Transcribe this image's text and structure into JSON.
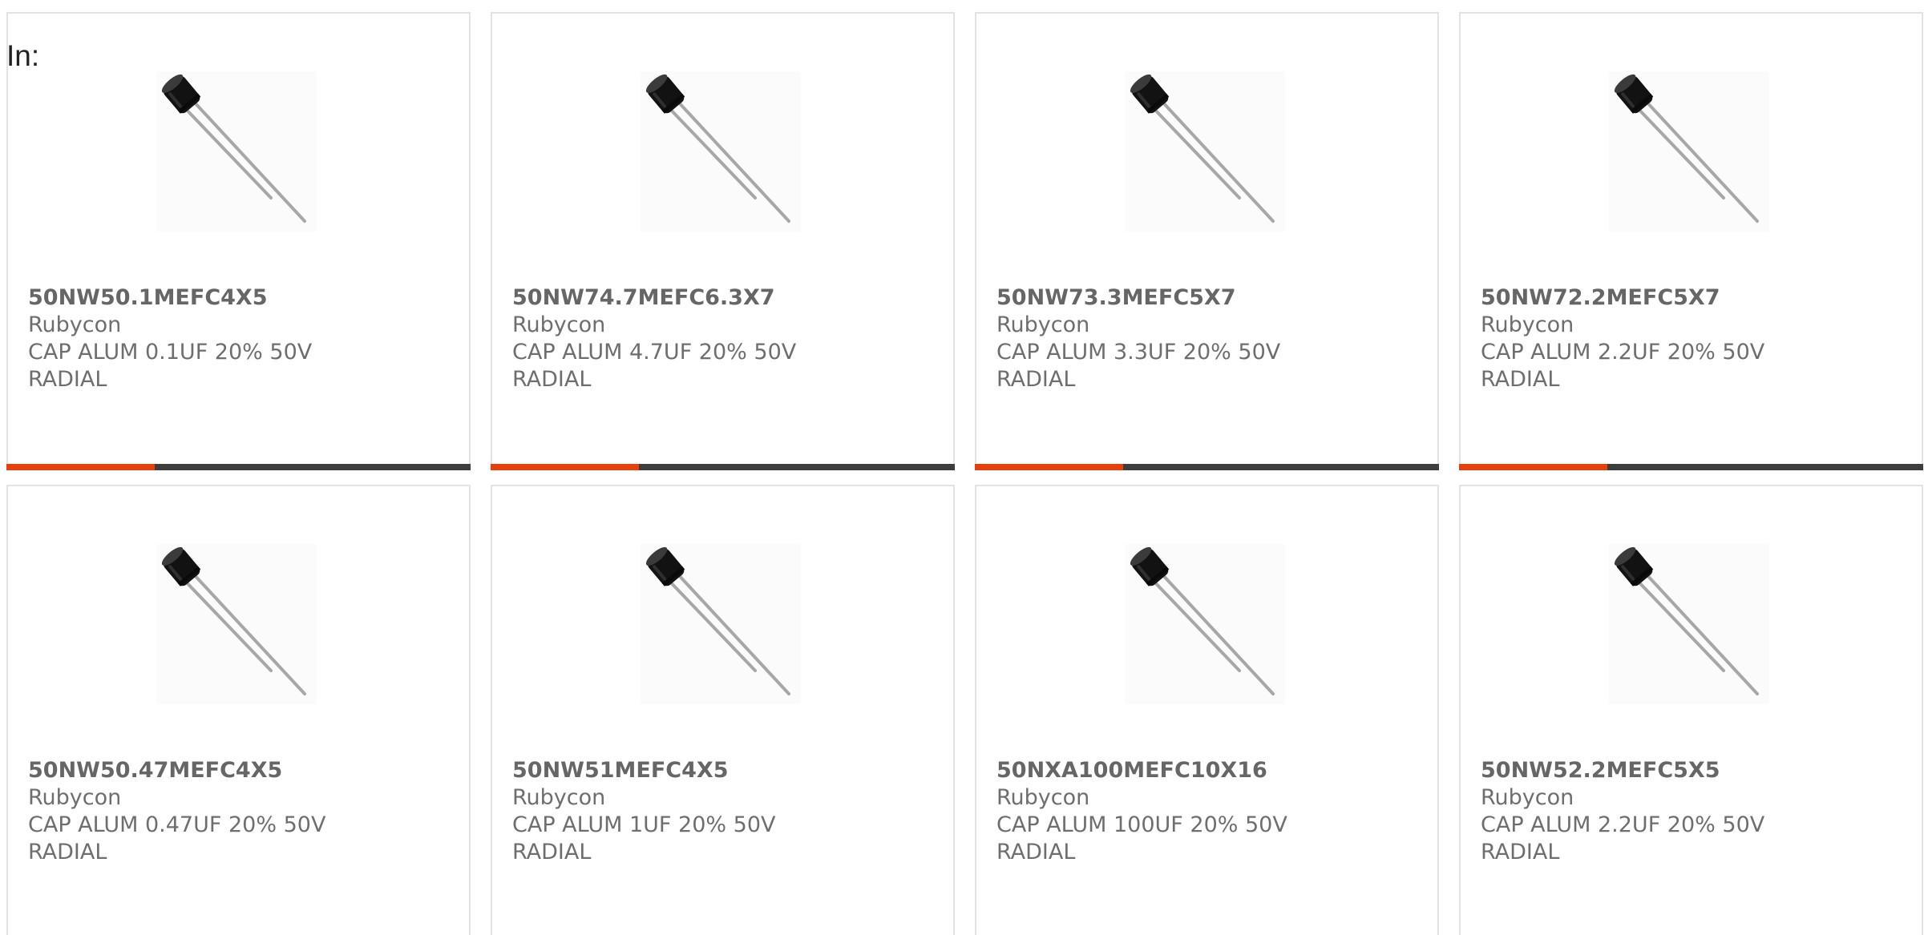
{
  "header": {
    "in_label": "In:"
  },
  "colors": {
    "accent": "#e8400c",
    "bar_base": "#3d3d3d",
    "border": "#e3e3e3",
    "text": "#6e6e6e"
  },
  "products": [
    {
      "part_number": "50NW50.1MEFC4X5",
      "manufacturer": "Rubycon",
      "description": "CAP ALUM 0.1UF 20% 50V RADIAL",
      "icon": "radial-capacitor-image",
      "progress": 0.32
    },
    {
      "part_number": "50NW74.7MEFC6.3X7",
      "manufacturer": "Rubycon",
      "description": "CAP ALUM 4.7UF 20% 50V RADIAL",
      "icon": "radial-capacitor-image",
      "progress": 0.32
    },
    {
      "part_number": "50NW73.3MEFC5X7",
      "manufacturer": "Rubycon",
      "description": "CAP ALUM 3.3UF 20% 50V RADIAL",
      "icon": "radial-capacitor-image",
      "progress": 0.32
    },
    {
      "part_number": "50NW72.2MEFC5X7",
      "manufacturer": "Rubycon",
      "description": "CAP ALUM 2.2UF 20% 50V RADIAL",
      "icon": "radial-capacitor-image",
      "progress": 0.32
    },
    {
      "part_number": "50NW50.47MEFC4X5",
      "manufacturer": "Rubycon",
      "description": "CAP ALUM 0.47UF 20% 50V RADIAL",
      "icon": "radial-capacitor-image",
      "progress": null
    },
    {
      "part_number": "50NW51MEFC4X5",
      "manufacturer": "Rubycon",
      "description": "CAP ALUM 1UF 20% 50V RADIAL",
      "icon": "radial-capacitor-image",
      "progress": null
    },
    {
      "part_number": "50NXA100MEFC10X16",
      "manufacturer": "Rubycon",
      "description": "CAP ALUM 100UF 20% 50V RADIAL",
      "icon": "radial-capacitor-image",
      "progress": null
    },
    {
      "part_number": "50NW52.2MEFC5X5",
      "manufacturer": "Rubycon",
      "description": "CAP ALUM 2.2UF 20% 50V RADIAL",
      "icon": "radial-capacitor-image",
      "progress": null
    }
  ]
}
